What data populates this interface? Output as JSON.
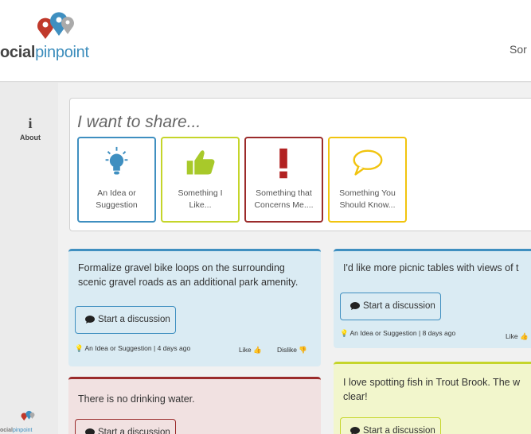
{
  "header": {
    "logo_text_dark": "ocial",
    "logo_text_blue": "pinpoint",
    "right_text": "Sor"
  },
  "sidebar": {
    "about_label": "About",
    "logo_text_dark": "ocial",
    "logo_text_blue": "pinpoint"
  },
  "share": {
    "title": "I want to share...",
    "cards": [
      {
        "line1": "An Idea or",
        "line2": "Suggestion",
        "color": "#3f8fc0",
        "icon": "lightbulb-icon"
      },
      {
        "line1": "Something I",
        "line2": "Like...",
        "color": "#c5d52a",
        "icon": "thumbs-up-icon"
      },
      {
        "line1": "Something that",
        "line2": "Concerns Me....",
        "color": "#9b2b2b",
        "icon": "exclamation-icon"
      },
      {
        "line1": "Something You",
        "line2": "Should Know...",
        "color": "#f1c40f",
        "icon": "speech-bubble-icon"
      }
    ]
  },
  "posts": [
    {
      "line1": "Formalize gravel bike loops on the surrounding",
      "line2": "scenic gravel roads as an additional park amenity.",
      "button": "Start a discussion",
      "category": "An Idea or Suggestion",
      "sep": "|",
      "time": "4 days ago",
      "like": "Like",
      "dislike": "Dislike",
      "bg": "#daebf3",
      "accent": "#3f8fc0"
    },
    {
      "line1": "I'd like more picnic tables with views of t",
      "line2": "",
      "button": "Start a discussion",
      "category": "An Idea or Suggestion",
      "sep": "|",
      "time": "8 days ago",
      "like": "Like",
      "bg": "#daebf3",
      "accent": "#3f8fc0"
    },
    {
      "line1": "There is no drinking water.",
      "button": "Start a discussion",
      "bg": "#f1e1e1",
      "accent": "#9b2b2b"
    },
    {
      "line1": "I love spotting fish in Trout Brook. The w",
      "line2": "clear!",
      "button": "Start a discussion",
      "bg": "#f2f6cc",
      "accent": "#c5d52a"
    }
  ]
}
